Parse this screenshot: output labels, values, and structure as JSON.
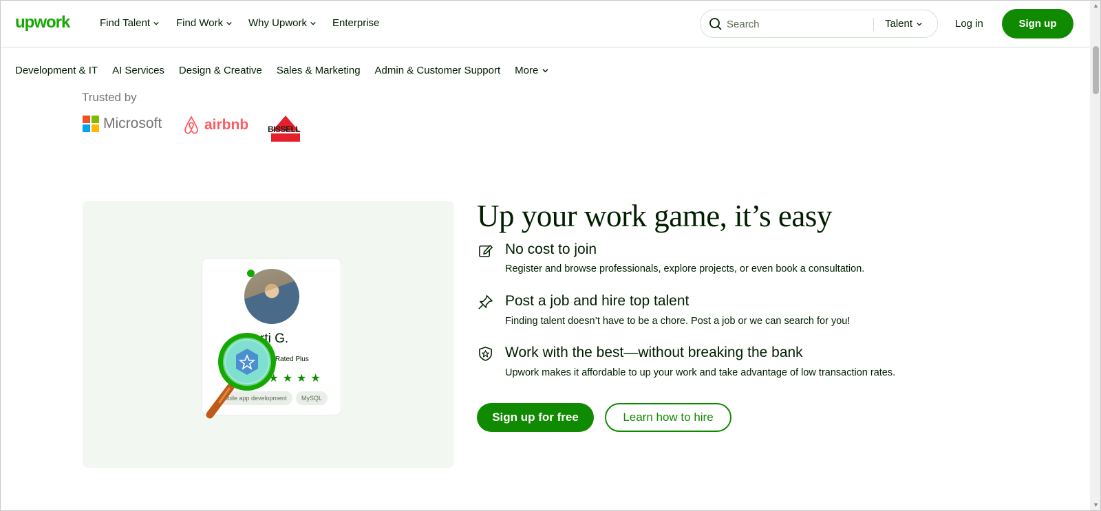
{
  "header": {
    "logo": "upwork",
    "nav": [
      {
        "label": "Find Talent",
        "dropdown": true
      },
      {
        "label": "Find Work",
        "dropdown": true
      },
      {
        "label": "Why Upwork",
        "dropdown": true
      },
      {
        "label": "Enterprise",
        "dropdown": false
      }
    ],
    "search": {
      "placeholder": "Search",
      "type": "Talent"
    },
    "login": "Log in",
    "signup": "Sign up"
  },
  "categories": [
    "Development & IT",
    "AI Services",
    "Design & Creative",
    "Sales & Marketing",
    "Admin & Customer Support",
    "More"
  ],
  "trusted": {
    "label": "Trusted by",
    "brands": [
      "Microsoft",
      "airbnb",
      "BISSELL"
    ]
  },
  "profile_card": {
    "name": "rti G.",
    "badge": "Top Rated Plus",
    "stars": 5,
    "skills": [
      "obile app development",
      "MySQL"
    ]
  },
  "main": {
    "headline": "Up your work game, it’s easy",
    "features": [
      {
        "icon": "edit-icon",
        "title": "No cost to join",
        "desc": "Register and browse professionals, explore projects, or even book a consultation."
      },
      {
        "icon": "pin-icon",
        "title": "Post a job and hire top talent",
        "desc": "Finding talent doesn’t have to be a chore. Post a job or we can search for you!"
      },
      {
        "icon": "shield-star-icon",
        "title": "Work with the best—without breaking the bank",
        "desc": "Upwork makes it affordable to up your work and take advantage of low transaction rates."
      }
    ],
    "cta_primary": "Sign up for free",
    "cta_secondary": "Learn how to hire"
  },
  "colors": {
    "brand_green": "#14a800",
    "button_green": "#108a00",
    "text_dark": "#001e00"
  }
}
